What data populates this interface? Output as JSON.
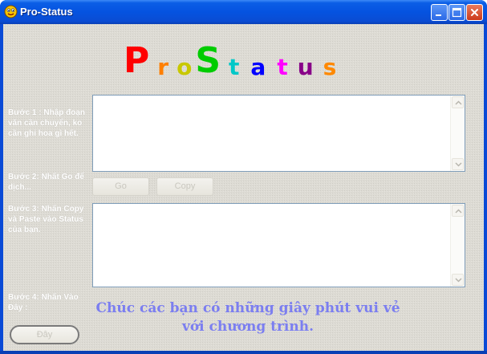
{
  "window": {
    "title": "Pro-Status"
  },
  "logo": {
    "letters": [
      {
        "char": "P",
        "color": "#ff0000",
        "size": "big"
      },
      {
        "char": "r",
        "color": "#ff7f00",
        "size": "small"
      },
      {
        "char": "o",
        "color": "#c8c800",
        "size": "small"
      },
      {
        "char": "S",
        "color": "#00cc00",
        "size": "big"
      },
      {
        "char": "t",
        "color": "#00c8c8",
        "size": "small"
      },
      {
        "char": "a",
        "color": "#0000ff",
        "size": "small"
      },
      {
        "char": "t",
        "color": "#ff00ff",
        "size": "small"
      },
      {
        "char": "u",
        "color": "#880088",
        "size": "small"
      },
      {
        "char": "s",
        "color": "#ff8800",
        "size": "small"
      }
    ]
  },
  "steps": {
    "step1": "Bước 1 : Nhập đoạn văn cần chuyển, ko cần ghi hoa gì hết.",
    "step2": "Bước 2: Nhất Go để dịch...",
    "step3": "Bước 3: Nhấn Copy và Paste vào Status của bạn.",
    "step4": "Bước 4: Nhấn Vào Đây :"
  },
  "buttons": {
    "go": "Go",
    "copy": "Copy",
    "here": "Đây"
  },
  "inputs": {
    "source_value": "",
    "result_value": ""
  },
  "message": {
    "line1": "Chúc các bạn có những giây phút vui vẻ",
    "line2": "với chương trình."
  },
  "icons": {
    "app": "smiley-face-icon",
    "minimize": "minimize-icon",
    "maximize": "maximize-icon",
    "close": "close-icon",
    "scroll_up": "chevron-up-icon",
    "scroll_down": "chevron-down-icon"
  }
}
